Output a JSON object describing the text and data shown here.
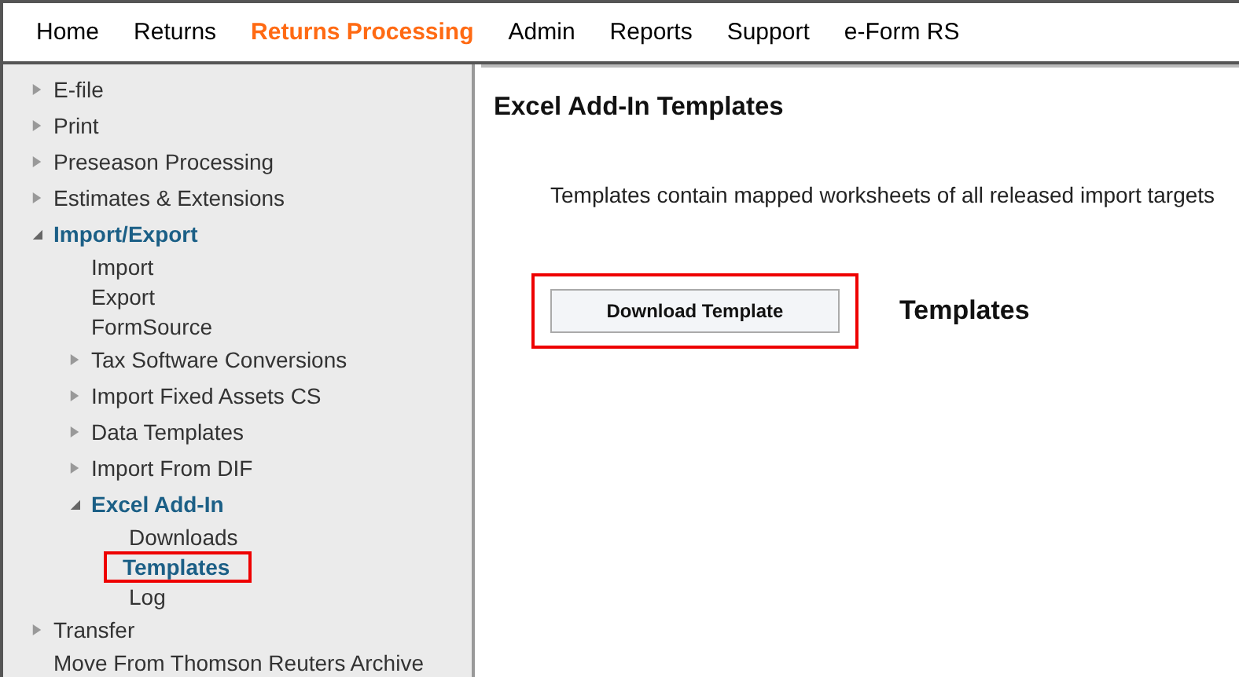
{
  "nav": [
    {
      "label": "Home",
      "selected": false
    },
    {
      "label": "Returns",
      "selected": false
    },
    {
      "label": "Returns Processing",
      "selected": true
    },
    {
      "label": "Admin",
      "selected": false
    },
    {
      "label": "Reports",
      "selected": false
    },
    {
      "label": "Support",
      "selected": false
    },
    {
      "label": "e-Form RS",
      "selected": false
    }
  ],
  "sidebar": {
    "items": [
      {
        "label": "E-file",
        "expanded": false,
        "highlighted": false
      },
      {
        "label": "Print",
        "expanded": false,
        "highlighted": false
      },
      {
        "label": "Preseason Processing",
        "expanded": false,
        "highlighted": false
      },
      {
        "label": "Estimates & Extensions",
        "expanded": false,
        "highlighted": false
      },
      {
        "label": "Import/Export",
        "expanded": true,
        "highlighted": false,
        "children": [
          {
            "label": "Import",
            "selected": false,
            "highlighted": false
          },
          {
            "label": "Export",
            "selected": false,
            "highlighted": false
          },
          {
            "label": "FormSource",
            "selected": false,
            "highlighted": false
          },
          {
            "label": "Tax Software Conversions",
            "expanded": false,
            "highlighted": false
          },
          {
            "label": "Import Fixed Assets CS",
            "expanded": false,
            "highlighted": false
          },
          {
            "label": "Data Templates",
            "expanded": false,
            "highlighted": false
          },
          {
            "label": "Import From DIF",
            "expanded": false,
            "highlighted": false
          },
          {
            "label": "Excel Add-In",
            "expanded": true,
            "highlighted": false,
            "children": [
              {
                "label": "Downloads",
                "selected": false,
                "highlighted": false
              },
              {
                "label": "Templates",
                "selected": true,
                "highlighted": true
              },
              {
                "label": "Log",
                "selected": false,
                "highlighted": false
              }
            ]
          }
        ]
      },
      {
        "label": "Transfer",
        "expanded": false,
        "highlighted": false
      },
      {
        "label": "Move From Thomson Reuters Archive",
        "selected": false,
        "highlighted": false
      }
    ]
  },
  "main": {
    "title": "Excel Add-In Templates",
    "description": "Templates contain mapped worksheets of all released import targets",
    "button": {
      "label": "Download Template",
      "highlighted": true
    },
    "section_label": "Templates"
  }
}
